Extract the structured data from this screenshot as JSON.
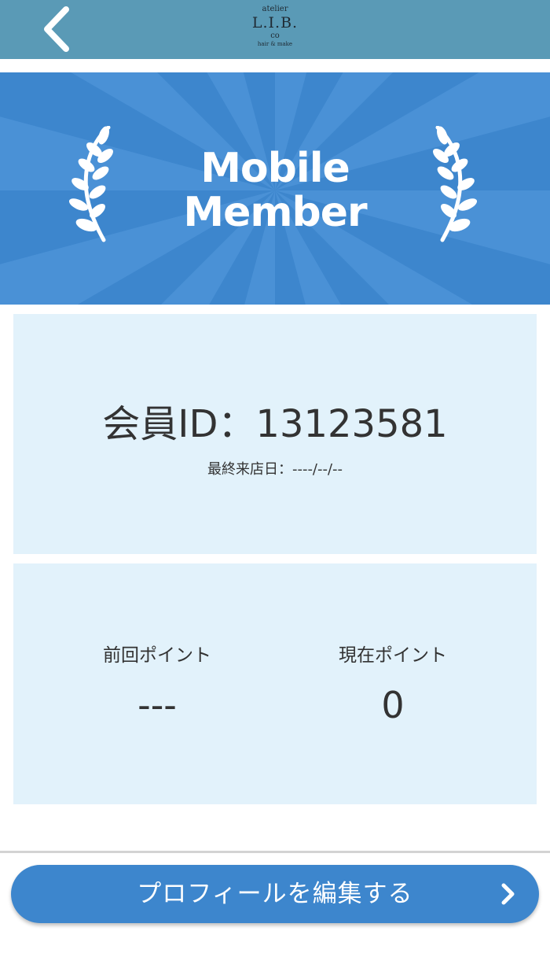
{
  "header": {
    "logo": {
      "line1": "atelier",
      "line2": "L.I.B.",
      "line3": "co",
      "line4": "hair & make"
    },
    "back_icon": "chevron-left-icon"
  },
  "banner": {
    "title_line1": "Mobile",
    "title_line2": "Member",
    "colors": {
      "background": "#3d86cd",
      "rays": "#4f94d8"
    }
  },
  "member_card": {
    "member_id": "会員ID：13123581",
    "last_visit": "最終来店日：----/--/--"
  },
  "points": {
    "previous_label": "前回ポイント",
    "previous_value": "---",
    "current_label": "現在ポイント",
    "current_value": "0"
  },
  "actions": {
    "edit_profile_label": "プロフィールを編集する",
    "edit_profile_icon": "chevron-right-icon"
  },
  "colors": {
    "header": "#5a9ab6",
    "accent": "#3d86cd",
    "card": "#e2f2fb"
  }
}
